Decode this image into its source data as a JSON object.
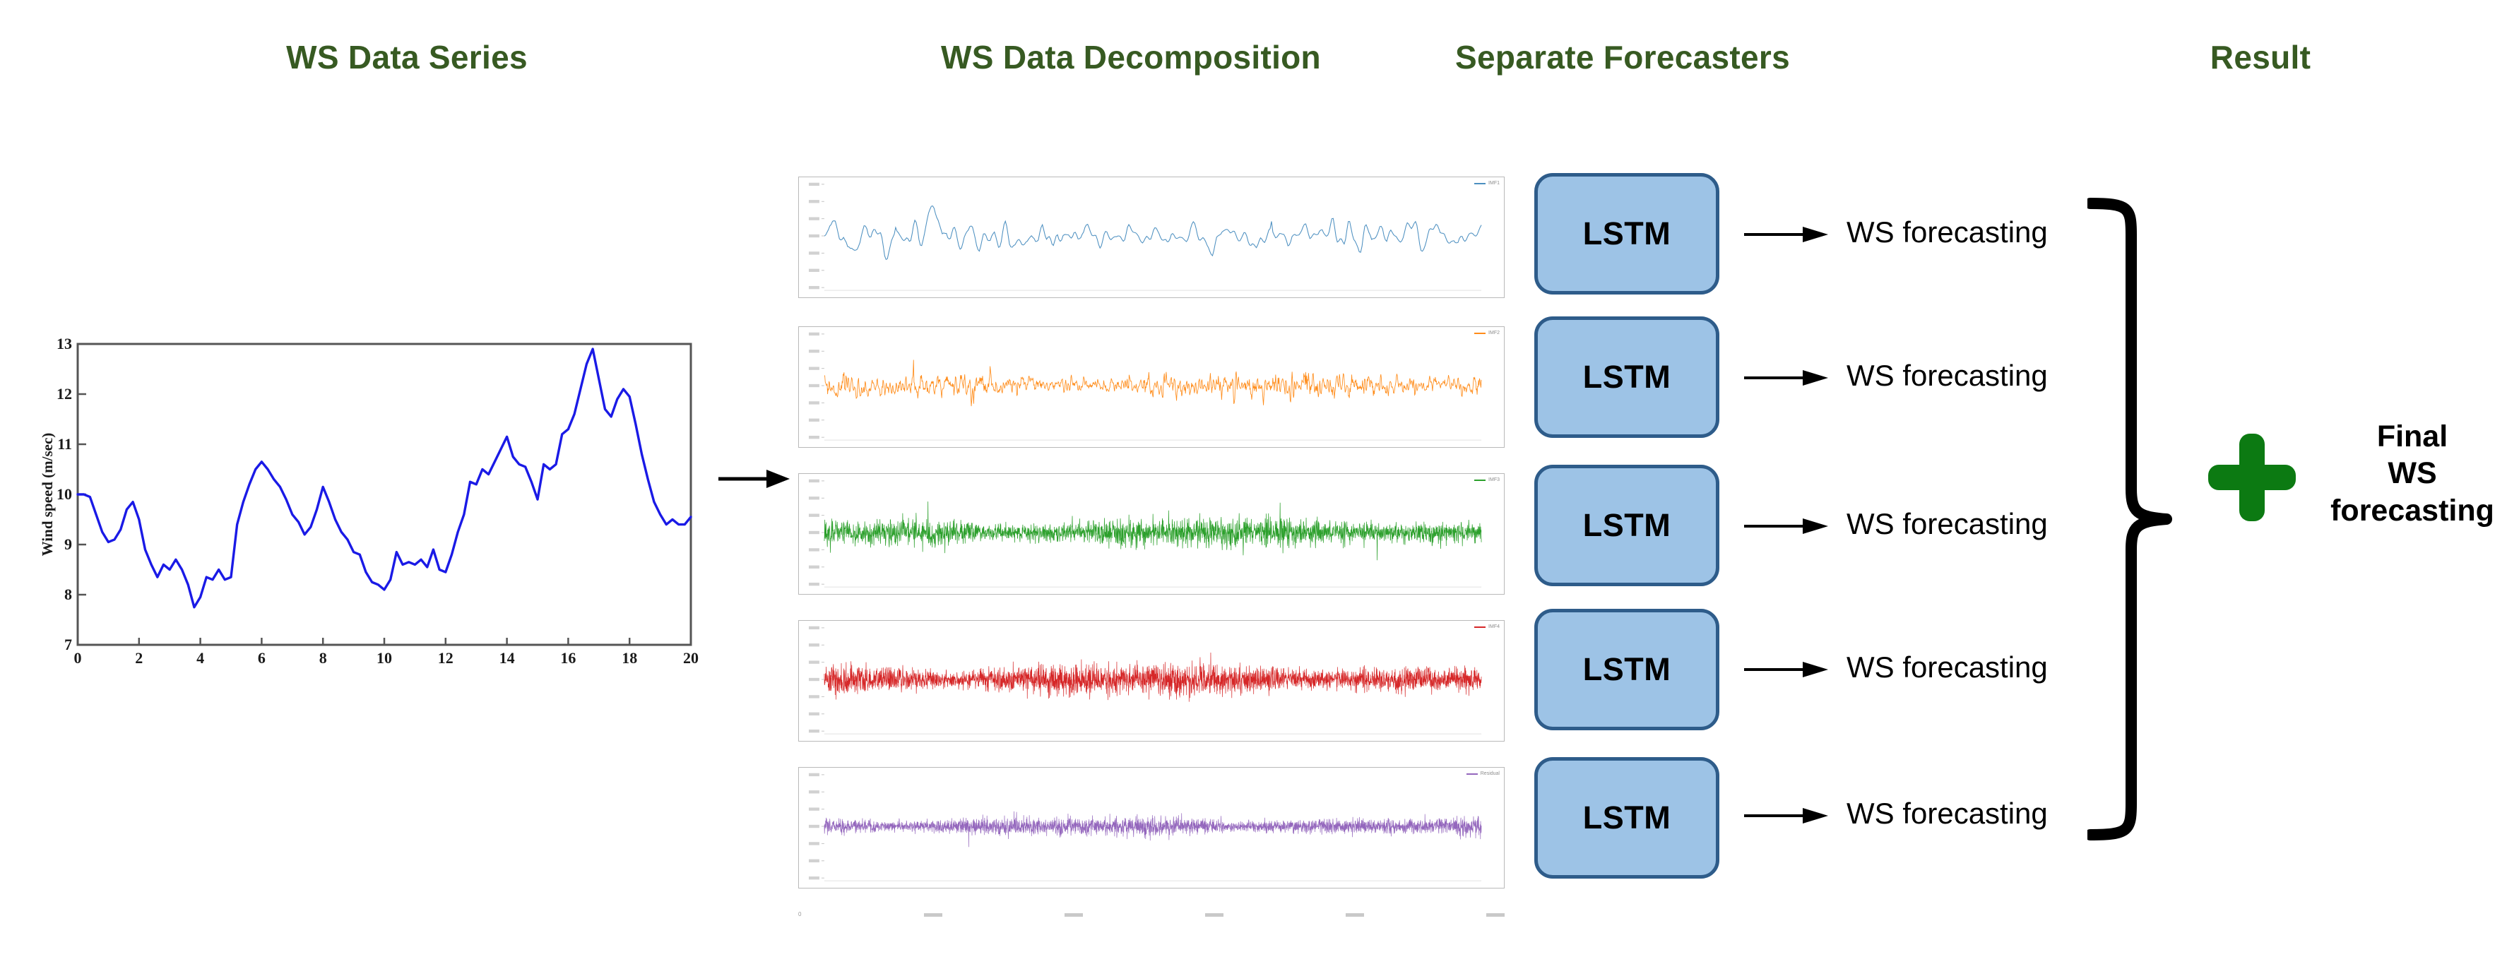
{
  "headers": {
    "series": "WS Data Series",
    "decomposition": "WS Data Decomposition",
    "forecasters": "Separate Forecasters",
    "result": "Result"
  },
  "colors": {
    "header_green": "#375A22",
    "plus_green": "#0C7A12",
    "lstm_fill": "#9DC3E6",
    "lstm_border": "#2E5C8A",
    "series_line": "#1A1AE6",
    "imf1": "#4C8FC0",
    "imf2": "#FF8C1A",
    "imf3": "#2CA02C",
    "imf4": "#D62728",
    "imf5": "#9467BD"
  },
  "ws_series_chart": {
    "ylabel": "Wind speed (m/sec)",
    "xlabel": "",
    "yticks": [
      "7",
      "8",
      "9",
      "10",
      "11",
      "12",
      "13"
    ],
    "xticks": [
      "0",
      "2",
      "4",
      "6",
      "8",
      "10",
      "12",
      "14",
      "16",
      "18",
      "20"
    ]
  },
  "decomposition": {
    "panels": [
      {
        "name": "imf-1",
        "color": "#4C8FC0",
        "legend": "IMF1",
        "yticks": [
          "",
          "",
          "",
          "",
          ""
        ]
      },
      {
        "name": "imf-2",
        "color": "#FF8C1A",
        "legend": "IMF2",
        "yticks": [
          "",
          "",
          "",
          "",
          ""
        ]
      },
      {
        "name": "imf-3",
        "color": "#2CA02C",
        "legend": "IMF3",
        "yticks": [
          "",
          "",
          "",
          "",
          ""
        ]
      },
      {
        "name": "imf-4",
        "color": "#D62728",
        "legend": "IMF4",
        "yticks": [
          "",
          "",
          "",
          "",
          ""
        ]
      },
      {
        "name": "imf-5",
        "color": "#9467BD",
        "legend": "Residual",
        "yticks": [
          "",
          "",
          "",
          "",
          ""
        ]
      }
    ],
    "xticks": [
      "0",
      "",
      "",
      "",
      "",
      ""
    ]
  },
  "forecasters": {
    "lstm_label": "LSTM",
    "rows": [
      {
        "model": "LSTM",
        "output": "WS forecasting"
      },
      {
        "model": "LSTM",
        "output": "WS forecasting"
      },
      {
        "model": "LSTM",
        "output": "WS forecasting"
      },
      {
        "model": "LSTM",
        "output": "WS forecasting"
      },
      {
        "model": "LSTM",
        "output": "WS forecasting"
      }
    ]
  },
  "result": {
    "operator": "+",
    "final_line1": "Final",
    "final_line2": "WS",
    "final_line3": "forecasting"
  },
  "chart_data": {
    "type": "line",
    "title": "WS Data Series",
    "xlabel": "",
    "ylabel": "Wind speed (m/sec)",
    "xlim": [
      0,
      20
    ],
    "ylim": [
      7,
      13
    ],
    "xticks": [
      0,
      2,
      4,
      6,
      8,
      10,
      12,
      14,
      16,
      18,
      20
    ],
    "yticks": [
      7,
      8,
      9,
      10,
      11,
      12,
      13
    ],
    "grid": false,
    "legend": "none",
    "series": [
      {
        "name": "Wind speed",
        "color": "#1A1AE6",
        "x": [
          0.0,
          0.2,
          0.4,
          0.6,
          0.8,
          1.0,
          1.2,
          1.4,
          1.6,
          1.8,
          2.0,
          2.2,
          2.4,
          2.6,
          2.8,
          3.0,
          3.2,
          3.4,
          3.6,
          3.8,
          4.0,
          4.2,
          4.4,
          4.6,
          4.8,
          5.0,
          5.2,
          5.4,
          5.6,
          5.8,
          6.0,
          6.2,
          6.4,
          6.6,
          6.8,
          7.0,
          7.2,
          7.4,
          7.6,
          7.8,
          8.0,
          8.2,
          8.4,
          8.6,
          8.8,
          9.0,
          9.2,
          9.4,
          9.6,
          9.8,
          10.0,
          10.2,
          10.4,
          10.6,
          10.8,
          11.0,
          11.2,
          11.4,
          11.6,
          11.8,
          12.0,
          12.2,
          12.4,
          12.6,
          12.8,
          13.0,
          13.2,
          13.4,
          13.6,
          13.8,
          14.0,
          14.2,
          14.4,
          14.6,
          14.8,
          15.0,
          15.2,
          15.4,
          15.6,
          15.8,
          16.0,
          16.2,
          16.4,
          16.6,
          16.8,
          17.0,
          17.2,
          17.4,
          17.6,
          17.8,
          18.0,
          18.2,
          18.4,
          18.6,
          18.8,
          19.0,
          19.2,
          19.4,
          19.6,
          19.8,
          20.0
        ],
        "y": [
          10.0,
          10.0,
          9.95,
          9.6,
          9.25,
          9.05,
          9.1,
          9.3,
          9.7,
          9.85,
          9.5,
          8.9,
          8.6,
          8.35,
          8.6,
          8.5,
          8.7,
          8.5,
          8.2,
          7.75,
          7.95,
          8.35,
          8.3,
          8.5,
          8.3,
          8.35,
          9.4,
          9.85,
          10.2,
          10.5,
          10.65,
          10.5,
          10.3,
          10.15,
          9.9,
          9.6,
          9.45,
          9.2,
          9.35,
          9.7,
          10.15,
          9.85,
          9.5,
          9.25,
          9.1,
          8.85,
          8.8,
          8.45,
          8.25,
          8.2,
          8.1,
          8.3,
          8.85,
          8.6,
          8.65,
          8.6,
          8.7,
          8.55,
          8.9,
          8.5,
          8.45,
          8.8,
          9.25,
          9.6,
          10.25,
          10.2,
          10.5,
          10.4,
          10.65,
          10.9,
          11.15,
          10.75,
          10.6,
          10.55,
          10.25,
          9.9,
          10.6,
          10.5,
          10.6,
          11.2,
          11.3,
          11.6,
          12.1,
          12.6,
          12.9,
          12.3,
          11.7,
          11.55,
          11.9,
          12.1,
          11.95,
          11.4,
          10.8,
          10.3,
          9.85,
          9.6,
          9.4,
          9.5,
          9.4,
          9.4,
          9.55
        ]
      }
    ]
  }
}
